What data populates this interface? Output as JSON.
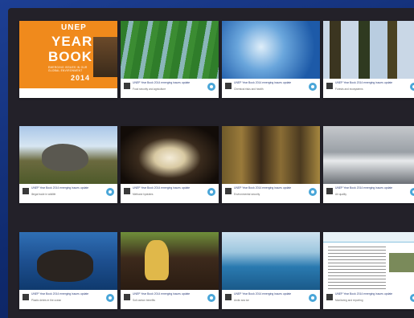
{
  "cover": {
    "line1": "UNEP",
    "line2": "YEAR",
    "line3": "BOOK",
    "subtitle": "EMERGING ISSUES IN OUR GLOBAL ENVIRONMENT",
    "year": "2014"
  },
  "cards": [
    {
      "caption": "UNEP Year Book 2014 emerging issues update",
      "sub": "Food security and agriculture"
    },
    {
      "caption": "UNEP Year Book 2014 emerging issues update",
      "sub": "Chemical risks and health"
    },
    {
      "caption": "UNEP Year Book 2014 emerging issues update",
      "sub": "Forests and ecosystems"
    },
    {
      "caption": "UNEP Year Book 2014 emerging issues update",
      "sub": "Illegal trade in wildlife"
    },
    {
      "caption": "UNEP Year Book 2014 emerging issues update",
      "sub": "Methane hydrates"
    },
    {
      "caption": "UNEP Year Book 2014 emerging issues update",
      "sub": "Environmental security"
    },
    {
      "caption": "UNEP Year Book 2014 emerging issues update",
      "sub": "Air quality"
    },
    {
      "caption": "UNEP Year Book 2014 emerging issues update",
      "sub": "Plastic debris in the ocean"
    },
    {
      "caption": "UNEP Year Book 2014 emerging issues update",
      "sub": "Soil carbon benefits"
    },
    {
      "caption": "UNEP Year Book 2014 emerging issues update",
      "sub": "Arctic sea ice"
    },
    {
      "caption": "UNEP Year Book 2014 emerging issues update",
      "sub": "Monitoring and reporting"
    }
  ]
}
